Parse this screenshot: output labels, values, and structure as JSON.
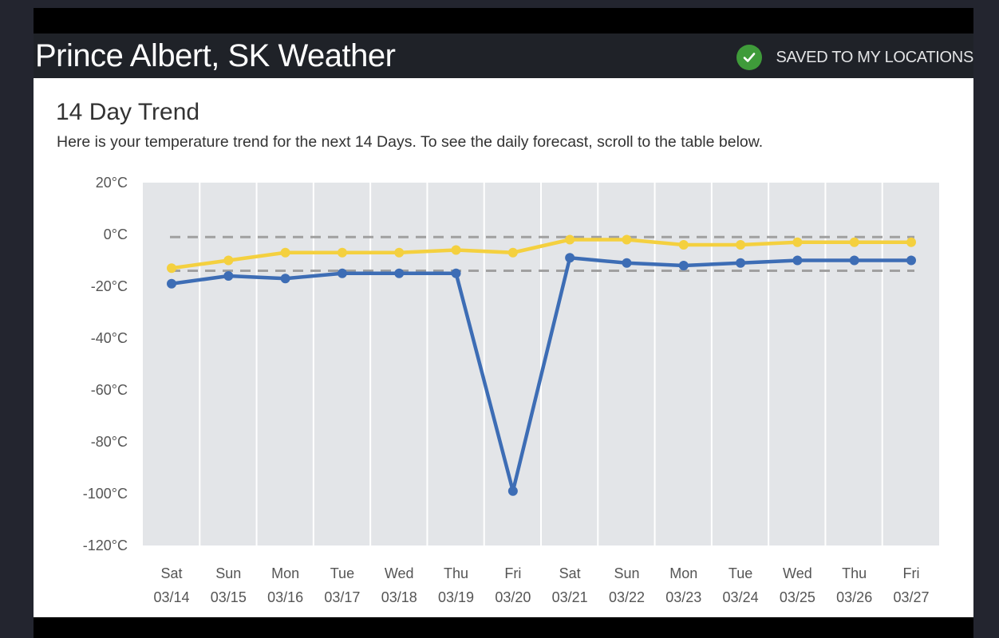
{
  "header": {
    "title": "Prince Albert, SK Weather",
    "saved_label": "SAVED TO MY LOCATIONS",
    "saved_icon": "check-circle-icon"
  },
  "trend": {
    "title": "14 Day Trend",
    "subtitle": "Here is your temperature trend for the next 14 Days. To see the daily forecast, scroll to the table below."
  },
  "colors": {
    "high": "#f4d03f",
    "low": "#3d6db5",
    "plot_bg": "#e3e5e8",
    "normal_line": "#a0a0a0",
    "saved_icon_bg": "#3f9b3a"
  },
  "chart_data": {
    "type": "line",
    "days": [
      "Sat",
      "Sun",
      "Mon",
      "Tue",
      "Wed",
      "Thu",
      "Fri",
      "Sat",
      "Sun",
      "Mon",
      "Tue",
      "Wed",
      "Thu",
      "Fri"
    ],
    "dates": [
      "03/14",
      "03/15",
      "03/16",
      "03/17",
      "03/18",
      "03/19",
      "03/20",
      "03/21",
      "03/22",
      "03/23",
      "03/24",
      "03/25",
      "03/26",
      "03/27"
    ],
    "yticks": [
      "20°C",
      "0°C",
      "-20°C",
      "-40°C",
      "-60°C",
      "-80°C",
      "-100°C",
      "-120°C"
    ],
    "ylim": [
      -120,
      20
    ],
    "grid": true,
    "normals": {
      "high": -1,
      "low": -14
    },
    "series": [
      {
        "values": [
          -13,
          -10,
          -7,
          -7,
          -7,
          -6,
          -7,
          -2,
          -2,
          -4,
          -4,
          -3,
          -3,
          -3
        ]
      },
      {
        "values": [
          -19,
          -16,
          -17,
          -15,
          -15,
          -15,
          -99,
          -9,
          -11,
          -12,
          -11,
          -10,
          -10,
          -10
        ]
      }
    ]
  }
}
